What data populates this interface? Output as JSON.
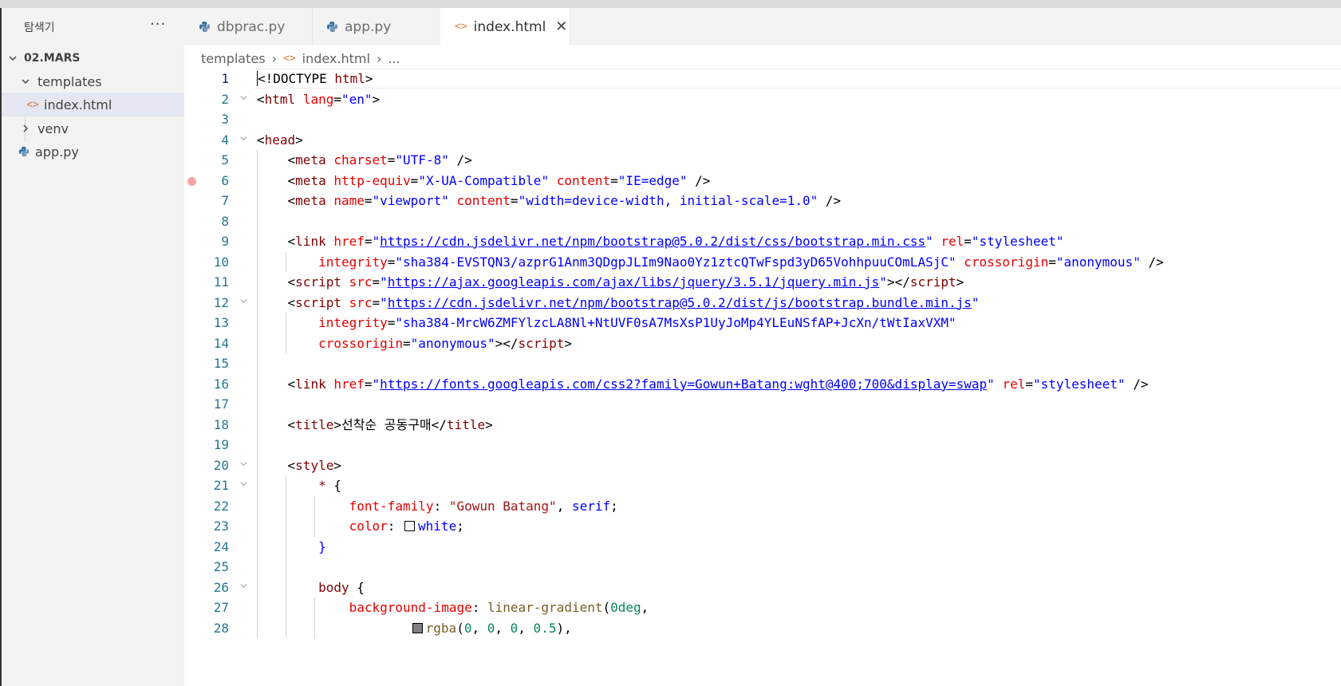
{
  "sidebar": {
    "title": "탐색기",
    "more": "···",
    "root": "02.MARS",
    "items": [
      {
        "label": "templates"
      },
      {
        "label": "index.html"
      },
      {
        "label": "venv"
      },
      {
        "label": "app.py"
      }
    ]
  },
  "tabs": [
    {
      "label": "dbprac.py",
      "icon": "python-icon"
    },
    {
      "label": "app.py",
      "icon": "python-icon"
    },
    {
      "label": "index.html",
      "icon": "html-icon",
      "close": "✕"
    }
  ],
  "breadcrumb": [
    "templates",
    "index.html",
    "..."
  ],
  "colors": {
    "sidebar_bg": "#f3f3f3",
    "selected_row": "#e4e6f1",
    "tag": "#800000",
    "attribute": "#e50000",
    "value": "#0000ff",
    "line_number": "#237893",
    "breakpoint": "#f3a7a1"
  },
  "editor": {
    "lines": [
      {
        "n": "1",
        "segs": [
          [
            "p",
            "<"
          ],
          [
            "p",
            "!DOCTYPE "
          ],
          [
            "t",
            "html"
          ],
          [
            "p",
            ">"
          ]
        ]
      },
      {
        "n": "2",
        "segs": [
          [
            "p",
            "<"
          ],
          [
            "t",
            "html "
          ],
          [
            "a",
            "lang"
          ],
          [
            "p",
            "="
          ],
          [
            "v",
            "\"en\""
          ],
          [
            "p",
            ">"
          ]
        ]
      },
      {
        "n": "3",
        "segs": []
      },
      {
        "n": "4",
        "segs": [
          [
            "p",
            "<"
          ],
          [
            "t",
            "head"
          ],
          [
            "p",
            ">"
          ]
        ]
      },
      {
        "n": "5",
        "segs": [
          [
            "p",
            "    <"
          ],
          [
            "t",
            "meta "
          ],
          [
            "a",
            "charset"
          ],
          [
            "p",
            "="
          ],
          [
            "v",
            "\"UTF-8\""
          ],
          [
            "p",
            " />"
          ]
        ]
      },
      {
        "n": "6",
        "segs": [
          [
            "p",
            "    <"
          ],
          [
            "t",
            "meta "
          ],
          [
            "a",
            "http-equiv"
          ],
          [
            "p",
            "="
          ],
          [
            "v",
            "\"X-UA-Compatible\""
          ],
          [
            "p",
            " "
          ],
          [
            "a",
            "content"
          ],
          [
            "p",
            "="
          ],
          [
            "v",
            "\"IE=edge\""
          ],
          [
            "p",
            " />"
          ]
        ]
      },
      {
        "n": "7",
        "segs": [
          [
            "p",
            "    <"
          ],
          [
            "t",
            "meta "
          ],
          [
            "a",
            "name"
          ],
          [
            "p",
            "="
          ],
          [
            "v",
            "\"viewport\""
          ],
          [
            "p",
            " "
          ],
          [
            "a",
            "content"
          ],
          [
            "p",
            "="
          ],
          [
            "v",
            "\"width=device-width, initial-scale=1.0\""
          ],
          [
            "p",
            " />"
          ]
        ]
      },
      {
        "n": "8",
        "segs": []
      },
      {
        "n": "9",
        "segs": [
          [
            "p",
            "    <"
          ],
          [
            "t",
            "link "
          ],
          [
            "a",
            "href"
          ],
          [
            "p",
            "="
          ],
          [
            "v",
            "\""
          ],
          [
            "vu",
            "https://cdn.jsdelivr.net/npm/bootstrap@5.0.2/dist/css/bootstrap.min.css"
          ],
          [
            "v",
            "\""
          ],
          [
            "p",
            " "
          ],
          [
            "a",
            "rel"
          ],
          [
            "p",
            "="
          ],
          [
            "v",
            "\"stylesheet\""
          ]
        ]
      },
      {
        "n": "10",
        "segs": [
          [
            "p",
            "        "
          ],
          [
            "a",
            "integrity"
          ],
          [
            "p",
            "="
          ],
          [
            "v",
            "\"sha384-EVSTQN3/azprG1Anm3QDgpJLIm9Nao0Yz1ztcQTwFspd3yD65VohhpuuCOmLASjC\""
          ],
          [
            "p",
            " "
          ],
          [
            "a",
            "crossorigin"
          ],
          [
            "p",
            "="
          ],
          [
            "v",
            "\"anonymous\""
          ],
          [
            "p",
            " />"
          ]
        ]
      },
      {
        "n": "11",
        "segs": [
          [
            "p",
            "    <"
          ],
          [
            "t",
            "script "
          ],
          [
            "a",
            "src"
          ],
          [
            "p",
            "="
          ],
          [
            "v",
            "\""
          ],
          [
            "vu",
            "https://ajax.googleapis.com/ajax/libs/jquery/3.5.1/jquery.min.js"
          ],
          [
            "v",
            "\""
          ],
          [
            "p",
            "></"
          ],
          [
            "t",
            "script"
          ],
          [
            "p",
            ">"
          ]
        ]
      },
      {
        "n": "12",
        "segs": [
          [
            "p",
            "    <"
          ],
          [
            "t",
            "script "
          ],
          [
            "a",
            "src"
          ],
          [
            "p",
            "="
          ],
          [
            "v",
            "\""
          ],
          [
            "vu",
            "https://cdn.jsdelivr.net/npm/bootstrap@5.0.2/dist/js/bootstrap.bundle.min.js"
          ],
          [
            "v",
            "\""
          ]
        ]
      },
      {
        "n": "13",
        "segs": [
          [
            "p",
            "        "
          ],
          [
            "a",
            "integrity"
          ],
          [
            "p",
            "="
          ],
          [
            "v",
            "\"sha384-MrcW6ZMFYlzcLA8Nl+NtUVF0sA7MsXsP1UyJoMp4YLEuNSfAP+JcXn/tWtIaxVXM\""
          ]
        ]
      },
      {
        "n": "14",
        "segs": [
          [
            "p",
            "        "
          ],
          [
            "a",
            "crossorigin"
          ],
          [
            "p",
            "="
          ],
          [
            "v",
            "\"anonymous\""
          ],
          [
            "p",
            "></"
          ],
          [
            "t",
            "script"
          ],
          [
            "p",
            ">"
          ]
        ]
      },
      {
        "n": "15",
        "segs": []
      },
      {
        "n": "16",
        "segs": [
          [
            "p",
            "    <"
          ],
          [
            "t",
            "link "
          ],
          [
            "a",
            "href"
          ],
          [
            "p",
            "="
          ],
          [
            "v",
            "\""
          ],
          [
            "vu",
            "https://fonts.googleapis.com/css2?family=Gowun+Batang:wght@400;700&display=swap"
          ],
          [
            "v",
            "\""
          ],
          [
            "p",
            " "
          ],
          [
            "a",
            "rel"
          ],
          [
            "p",
            "="
          ],
          [
            "v",
            "\"stylesheet\""
          ],
          [
            "p",
            " />"
          ]
        ]
      },
      {
        "n": "17",
        "segs": []
      },
      {
        "n": "18",
        "segs": [
          [
            "p",
            "    <"
          ],
          [
            "t",
            "title"
          ],
          [
            "p",
            ">선착순 공동구매</"
          ],
          [
            "t",
            "title"
          ],
          [
            "p",
            ">"
          ]
        ]
      },
      {
        "n": "19",
        "segs": []
      },
      {
        "n": "20",
        "segs": [
          [
            "p",
            "    <"
          ],
          [
            "t",
            "style"
          ],
          [
            "p",
            ">"
          ]
        ]
      },
      {
        "n": "21",
        "segs": [
          [
            "p",
            "        "
          ],
          [
            "t",
            "*"
          ],
          [
            "p",
            " {"
          ]
        ]
      },
      {
        "n": "22",
        "segs": [
          [
            "p",
            "            "
          ],
          [
            "a",
            "font-family"
          ],
          [
            "p",
            ": "
          ],
          [
            "s",
            "\"Gowun Batang\""
          ],
          [
            "p",
            ", "
          ],
          [
            "k",
            "serif"
          ],
          [
            "p",
            ";"
          ]
        ]
      },
      {
        "n": "23",
        "segs": [
          [
            "p",
            "            "
          ],
          [
            "a",
            "color"
          ],
          [
            "p",
            ": "
          ],
          [
            "sw",
            "#ffffff"
          ],
          [
            "k",
            "white"
          ],
          [
            "p",
            ";"
          ]
        ]
      },
      {
        "n": "24",
        "segs": [
          [
            "p",
            "        "
          ],
          [
            "k",
            "}"
          ]
        ]
      },
      {
        "n": "25",
        "segs": []
      },
      {
        "n": "26",
        "segs": [
          [
            "p",
            "        "
          ],
          [
            "t",
            "body"
          ],
          [
            "p",
            " {"
          ]
        ]
      },
      {
        "n": "27",
        "segs": [
          [
            "p",
            "            "
          ],
          [
            "a",
            "background-image"
          ],
          [
            "p",
            ": "
          ],
          [
            "fn",
            "linear-gradient"
          ],
          [
            "p",
            "("
          ],
          [
            "n",
            "0deg"
          ],
          [
            "p",
            ","
          ]
        ]
      },
      {
        "n": "28",
        "segs": [
          [
            "p",
            "                    "
          ],
          [
            "sw",
            "#7f7f7f"
          ],
          [
            "fn",
            "rgba"
          ],
          [
            "p",
            "("
          ],
          [
            "n",
            "0"
          ],
          [
            "p",
            ", "
          ],
          [
            "n",
            "0"
          ],
          [
            "p",
            ", "
          ],
          [
            "n",
            "0"
          ],
          [
            "p",
            ", "
          ],
          [
            "n",
            "0.5"
          ],
          [
            "p",
            "),"
          ]
        ]
      }
    ]
  }
}
